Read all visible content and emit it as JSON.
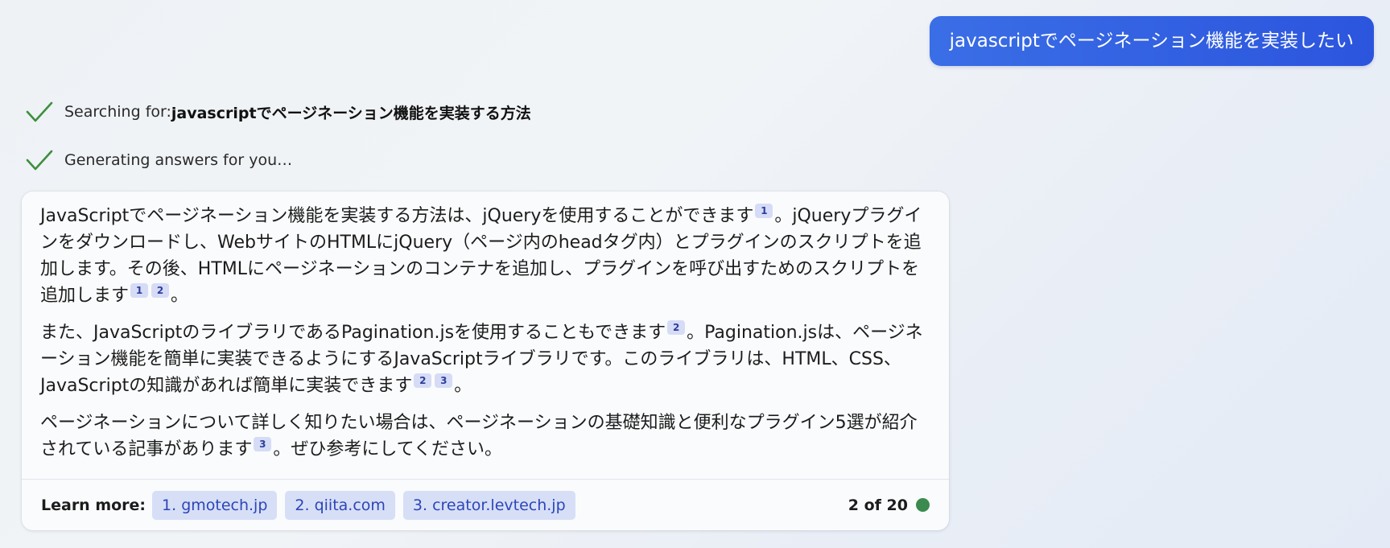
{
  "user_message": "javascriptでページネーション機能を実装したい",
  "status": {
    "searching_prefix": "Searching for: ",
    "searching_query": "javascriptでページネーション機能を実装する方法",
    "generating": "Generating answers for you…"
  },
  "answer": {
    "p1": {
      "s1": "JavaScriptでページネーション機能を実装する方法は、jQueryを使用することができます",
      "r1": "1",
      "s2": "。jQueryプラグインをダウンロードし、WebサイトのHTMLにjQuery（ページ内のheadタグ内）とプラグインのスクリプトを追加します。その後、HTMLにページネーションのコンテナを追加し、プラグインを呼び出すためのスクリプトを追加します",
      "r2": "1",
      "r3": "2",
      "s3": "。"
    },
    "p2": {
      "s1": "また、JavaScriptのライブラリであるPagination.jsを使用することもできます",
      "r1": "2",
      "s2": "。Pagination.jsは、ページネーション機能を簡単に実装できるようにするJavaScriptライブラリです。このライブラリは、HTML、CSS、JavaScriptの知識があれば簡単に実装できます",
      "r2": "2",
      "r3": "3",
      "s3": "。"
    },
    "p3": {
      "s1": "ページネーションについて詳しく知りたい場合は、ページネーションの基礎知識と便利なプラグイン5選が紹介されている記事があります",
      "r1": "3",
      "s2": "。ぜひ参考にしてください。"
    }
  },
  "footer": {
    "learn_more": "Learn more:",
    "links": [
      "1. gmotech.jp",
      "2. qiita.com",
      "3. creator.levtech.jp"
    ],
    "counter": "2 of 20"
  },
  "colors": {
    "user_bubble": "#2c55de",
    "check": "#3d8f3d",
    "status_dot": "#3b8a4e",
    "chip_bg": "#d7dff7",
    "chip_text": "#2d45b8"
  }
}
